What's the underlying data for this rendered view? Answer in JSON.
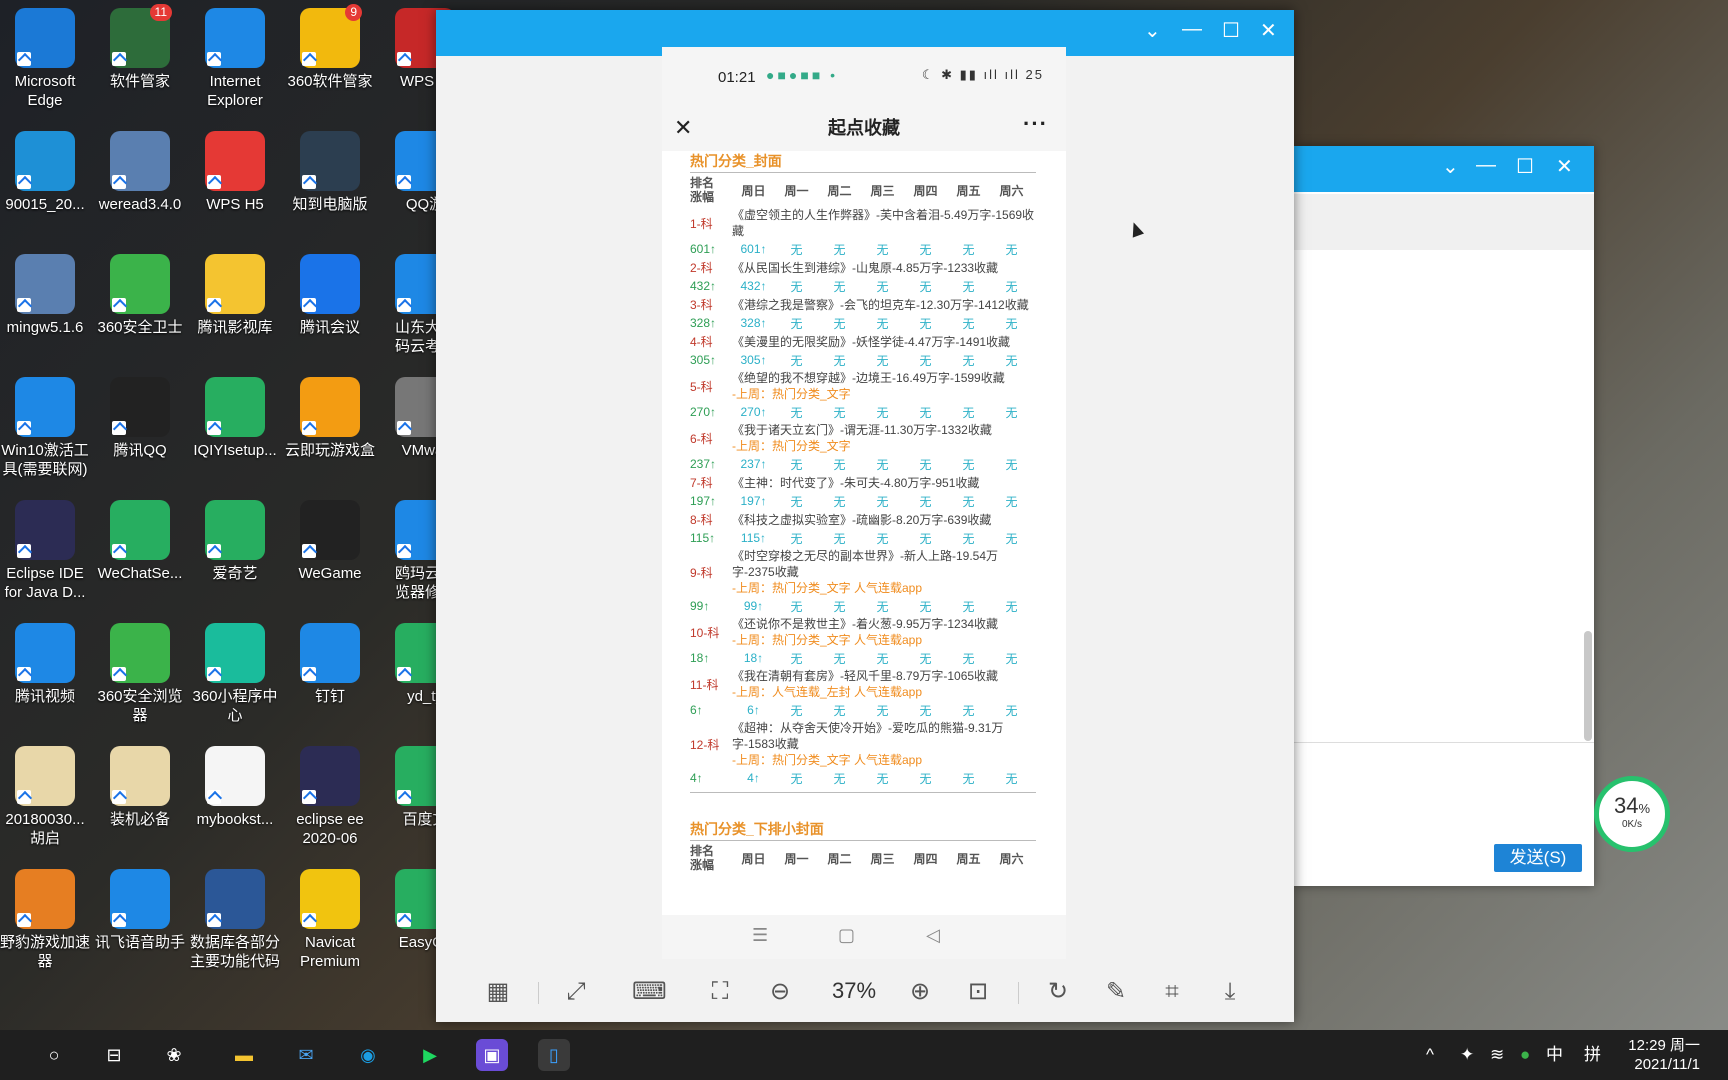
{
  "desktop_icons": [
    {
      "label": "Microsoft Edge",
      "color": "#1b79d6"
    },
    {
      "label": "软件管家",
      "color": "#2d6c3a",
      "badge": "11"
    },
    {
      "label": "Internet Explorer",
      "color": "#1e88e5"
    },
    {
      "label": "360软件管家",
      "color": "#f2b90d",
      "badge": "9"
    },
    {
      "label": "WPS O",
      "color": "#c62828"
    },
    {
      "label": "90015_20...",
      "color": "#1e90d6"
    },
    {
      "label": "weread3.4.0",
      "color": "#5a7fb0"
    },
    {
      "label": "WPS H5",
      "color": "#e53935"
    },
    {
      "label": "知到电脑版",
      "color": "#2c3e50"
    },
    {
      "label": "QQ游",
      "color": "#1e88e5"
    },
    {
      "label": "mingw5.1.6",
      "color": "#5a7fb0"
    },
    {
      "label": "360安全卫士",
      "color": "#3bb34a"
    },
    {
      "label": "腾讯影视库",
      "color": "#f4c430"
    },
    {
      "label": "腾讯会议",
      "color": "#1a73e8"
    },
    {
      "label": "山东大学\n码云考试",
      "color": "#1e88e5"
    },
    {
      "label": "Win10激活工\n具(需要联网)",
      "color": "#1e88e5"
    },
    {
      "label": "腾讯QQ",
      "color": "#222"
    },
    {
      "label": "IQIYIsetup...",
      "color": "#27ae60"
    },
    {
      "label": "云即玩游戏盒",
      "color": "#f39c12"
    },
    {
      "label": "VMwar",
      "color": "#777"
    },
    {
      "label": "Eclipse IDE\nfor Java D...",
      "color": "#2c2c54"
    },
    {
      "label": "WeChatSe...",
      "color": "#27ae60"
    },
    {
      "label": "爱奇艺",
      "color": "#27ae60"
    },
    {
      "label": "WeGame",
      "color": "#222"
    },
    {
      "label": "鸥玛云考\n览器修复",
      "color": "#1e88e5"
    },
    {
      "label": "腾讯视频",
      "color": "#1e88e5"
    },
    {
      "label": "360安全浏览\n器",
      "color": "#3bb34a"
    },
    {
      "label": "360小程序中\n心",
      "color": "#1abc9c"
    },
    {
      "label": "钉钉",
      "color": "#1e88e5"
    },
    {
      "label": "yd_ty",
      "color": "#27ae60"
    },
    {
      "label": "20180030...\n胡启",
      "color": "#e8d7a9"
    },
    {
      "label": "装机必备",
      "color": "#e8d7a9"
    },
    {
      "label": "mybookst...",
      "color": "#f5f5f5"
    },
    {
      "label": "eclipse ee\n2020-06",
      "color": "#2c2c54"
    },
    {
      "label": "百度文",
      "color": "#27ae60"
    },
    {
      "label": "野豹游戏加速\n器",
      "color": "#e67e22"
    },
    {
      "label": "讯飞语音助手",
      "color": "#1e88e5"
    },
    {
      "label": "数据库各部分\n主要功能代码",
      "color": "#2b5797"
    },
    {
      "label": "Navicat\nPremium",
      "color": "#f1c40f"
    },
    {
      "label": "EasyCo",
      "color": "#27ae60"
    }
  ],
  "viewer": {
    "status_time": "01:21",
    "status_battery": "25",
    "page_title": "起点收藏",
    "section1": "热门分类_封面",
    "section2": "热门分类_下排小封面",
    "header": [
      "排名\n涨幅",
      "周日",
      "周一",
      "周二",
      "周三",
      "周四",
      "周五",
      "周六"
    ],
    "none": "无",
    "entries": [
      {
        "rank": "1-科",
        "book": "《虚空领主的人生作弊器》-芙中含着泪-5.49万字-1569收藏",
        "last": "",
        "gain": "601↑"
      },
      {
        "rank": "2-科",
        "book": "《从民国长生到港综》-山鬼原-4.85万字-1233收藏",
        "last": "",
        "gain": "432↑"
      },
      {
        "rank": "3-科",
        "book": "《港综之我是警察》-会飞的坦克车-12.30万字-1412收藏",
        "last": "",
        "gain": "328↑"
      },
      {
        "rank": "4-科",
        "book": "《美漫里的无限奖励》-妖怪学徒-4.47万字-1491收藏",
        "last": "",
        "gain": "305↑"
      },
      {
        "rank": "5-科",
        "book": "《绝望的我不想穿越》-边境王-16.49万字-1599收藏",
        "last": "-上周：热门分类_文字",
        "gain": "270↑"
      },
      {
        "rank": "6-科",
        "book": "《我于诸天立玄门》-谓无涯-11.30万字-1332收藏",
        "last": "-上周：热门分类_文字",
        "gain": "237↑"
      },
      {
        "rank": "7-科",
        "book": "《主神：时代变了》-朱可夫-4.80万字-951收藏",
        "last": "",
        "gain": "197↑"
      },
      {
        "rank": "8-科",
        "book": "《科技之虚拟实验室》-疏幽影-8.20万字-639收藏",
        "last": "",
        "gain": "115↑"
      },
      {
        "rank": "9-科",
        "book": "《时空穿梭之无尽的副本世界》-新人上路-19.54万字-2375收藏",
        "last": "-上周：热门分类_文字 人气连载app",
        "gain": "99↑"
      },
      {
        "rank": "10-科",
        "book": "《还说你不是救世主》-着火葱-9.95万字-1234收藏",
        "last": "-上周：热门分类_文字 人气连载app",
        "gain": "18↑"
      },
      {
        "rank": "11-科",
        "book": "《我在清朝有套房》-轻风千里-8.79万字-1065收藏",
        "last": "-上周：人气连载_左封 人气连载app",
        "gain": "6↑"
      },
      {
        "rank": "12-科",
        "book": "《超神：从夺舍天使冷开始》-爱吃瓜的熊猫-9.31万字-1583收藏",
        "last": "-上周：热门分类_文字 人气连载app",
        "gain": "4↑"
      }
    ],
    "zoom": "37%"
  },
  "chat_window": {
    "send_label": "发送(S)"
  },
  "speed_widget": {
    "percent": "34",
    "unit": "%",
    "rate": "0K/s"
  },
  "taskbar": {
    "ime": "中",
    "ime2": "拼",
    "time": "12:29 周一",
    "date": "2021/11/1"
  }
}
